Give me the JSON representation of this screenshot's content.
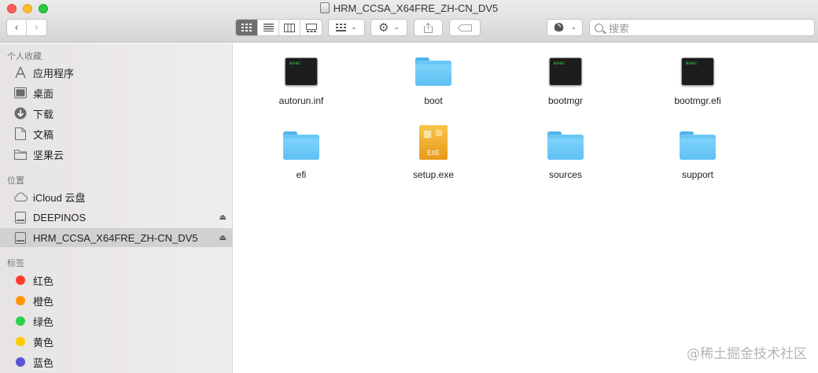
{
  "window": {
    "title": "HRM_CCSA_X64FRE_ZH-CN_DV5"
  },
  "toolbar": {
    "search_placeholder": "搜索"
  },
  "sidebar": {
    "favorites_title": "个人收藏",
    "favorites": [
      {
        "label": "应用程序",
        "icon": "apps-icon"
      },
      {
        "label": "桌面",
        "icon": "desktop-icon"
      },
      {
        "label": "下载",
        "icon": "download-icon"
      },
      {
        "label": "文稿",
        "icon": "document-icon"
      },
      {
        "label": "坚果云",
        "icon": "folder-icon"
      }
    ],
    "locations_title": "位置",
    "locations": [
      {
        "label": "iCloud 云盘",
        "icon": "cloud-icon"
      },
      {
        "label": "DEEPINOS",
        "icon": "drive-icon"
      },
      {
        "label": "HRM_CCSA_X64FRE_ZH-CN_DV5",
        "icon": "drive-icon",
        "selected": true
      }
    ],
    "tags_title": "标签",
    "tags": [
      {
        "label": "红色",
        "color": "#fe3b30"
      },
      {
        "label": "橙色",
        "color": "#ff9500"
      },
      {
        "label": "绿色",
        "color": "#2ad14c"
      },
      {
        "label": "黄色",
        "color": "#ffcc00"
      },
      {
        "label": "蓝色",
        "color": "#5856d6"
      }
    ]
  },
  "files": [
    {
      "name": "autorun.inf",
      "type": "exec"
    },
    {
      "name": "boot",
      "type": "folder"
    },
    {
      "name": "bootmgr",
      "type": "exec"
    },
    {
      "name": "bootmgr.efi",
      "type": "exec"
    },
    {
      "name": "efi",
      "type": "folder"
    },
    {
      "name": "setup.exe",
      "type": "exe"
    },
    {
      "name": "sources",
      "type": "folder"
    },
    {
      "name": "support",
      "type": "folder"
    }
  ],
  "icon_text": {
    "exec_badge": "exec",
    "exe_badge": "EXE"
  },
  "watermark": "@稀土掘金技术社区"
}
